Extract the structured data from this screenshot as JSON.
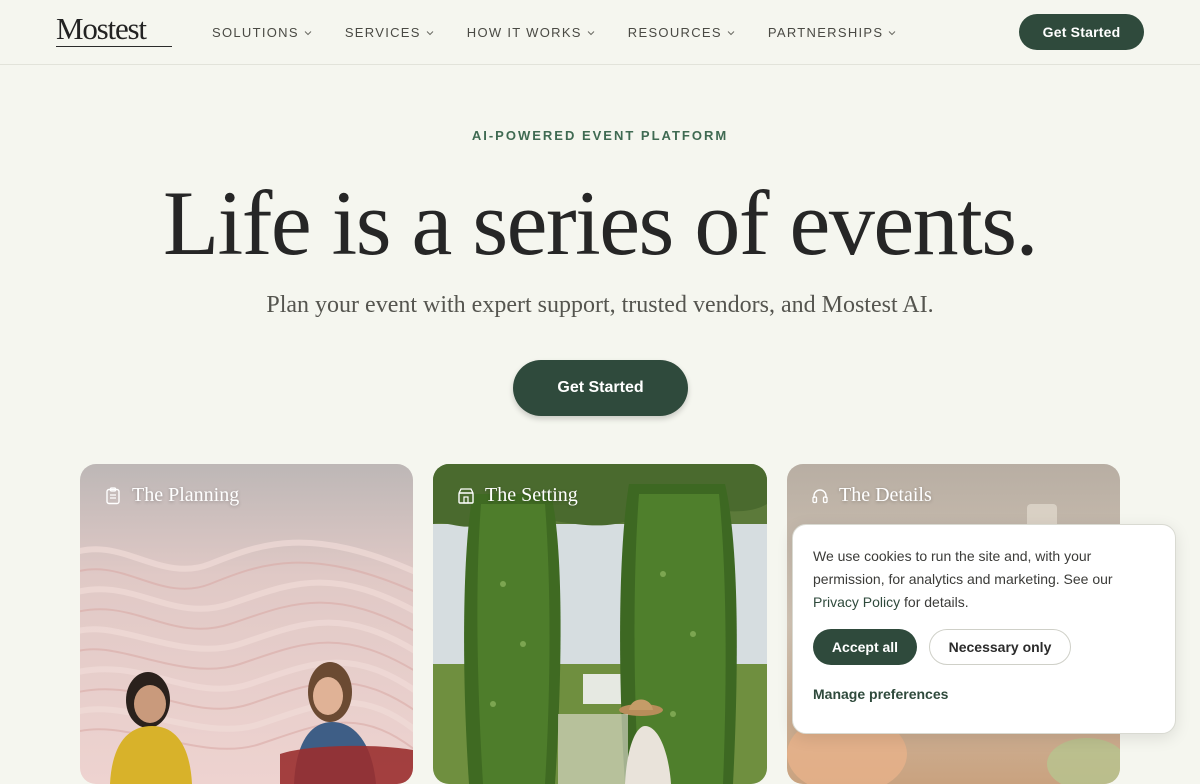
{
  "brand": {
    "logo_text": "Mostest"
  },
  "nav": {
    "items": [
      {
        "label": "SOLUTIONS"
      },
      {
        "label": "SERVICES"
      },
      {
        "label": "HOW IT WORKS"
      },
      {
        "label": "RESOURCES"
      },
      {
        "label": "PARTNERSHIPS"
      }
    ],
    "cta_label": "Get Started"
  },
  "hero": {
    "eyebrow": "AI-POWERED EVENT PLATFORM",
    "headline": "Life is a series of events.",
    "subheadline": "Plan your event with expert support, trusted vendors, and Mostest AI.",
    "cta_label": "Get Started"
  },
  "cards": [
    {
      "title": "The Planning",
      "icon": "clipboard-icon"
    },
    {
      "title": "The Setting",
      "icon": "venue-icon"
    },
    {
      "title": "The Details",
      "icon": "headset-icon"
    }
  ],
  "cookie_banner": {
    "text_before_link": "We use cookies to run the site and, with your permission, for analytics and marketing. See our ",
    "link_text": "Privacy Policy",
    "text_after_link": " for details.",
    "accept_label": "Accept all",
    "necessary_label": "Necessary only",
    "manage_label": "Manage preferences"
  },
  "colors": {
    "page_background": "#f5f6ef",
    "brand_green": "#2f4a3c",
    "eyebrow_green": "#3f6a52"
  }
}
